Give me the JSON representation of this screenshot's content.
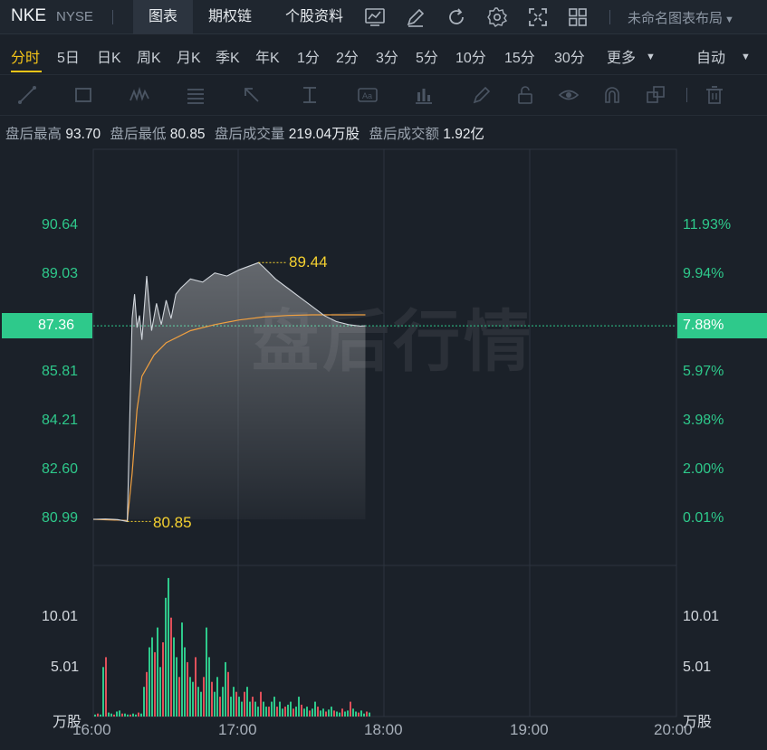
{
  "header": {
    "ticker": "NKE",
    "exchange": "NYSE",
    "tabs": [
      "图表",
      "期权链",
      "个股资料"
    ],
    "layout_name": "未命名图表布局"
  },
  "periods": {
    "items": [
      "分时",
      "5日",
      "日K",
      "周K",
      "月K",
      "季K",
      "年K",
      "1分",
      "2分",
      "3分",
      "5分",
      "10分",
      "15分",
      "30分",
      "更多"
    ],
    "active": "分时",
    "auto": "自动"
  },
  "toolbar_icons": [
    "trendline-icon",
    "rectangle-icon",
    "wave-icon",
    "fib-icon",
    "arrow-icon",
    "measure-icon",
    "text-icon",
    "indicator-icon",
    "pen-icon",
    "lock-icon",
    "eye-icon",
    "magnet-icon",
    "copy-icon",
    "trash-icon"
  ],
  "info": {
    "high_label": "盘后最高",
    "high_value": "93.70",
    "low_label": "盘后最低",
    "low_value": "80.85",
    "vol_label": "盘后成交量",
    "vol_value": "219.04万股",
    "amt_label": "盘后成交额",
    "amt_value": "1.92亿"
  },
  "axes": {
    "price_ticks": [
      "90.64",
      "89.03",
      "87.36",
      "85.81",
      "84.21",
      "82.60",
      "80.99"
    ],
    "pct_ticks": [
      "11.93%",
      "9.94%",
      "7.88%",
      "5.97%",
      "3.98%",
      "2.00%",
      "0.01%"
    ],
    "vol_ticks": [
      "10.01",
      "5.01"
    ],
    "vol_unit": "万股",
    "time_ticks": [
      "16:00",
      "17:00",
      "18:00",
      "19:00",
      "20:00"
    ]
  },
  "last_price": "87.36",
  "last_pct": "7.88%",
  "annotations": {
    "max_label": "89.44",
    "min_label": "80.85"
  },
  "watermark": "盘后行情",
  "chart_data": {
    "type": "line",
    "x_range": [
      "16:00",
      "20:00"
    ],
    "ylim": [
      80.99,
      90.64
    ],
    "series": [
      {
        "name": "price",
        "color": "#d0d5db",
        "x": [
          "16:00",
          "16:05",
          "16:10",
          "16:14",
          "16:15",
          "16:16",
          "16:17",
          "16:18",
          "16:19",
          "16:20",
          "16:22",
          "16:24",
          "16:26",
          "16:28",
          "16:30",
          "16:32",
          "16:34",
          "16:36",
          "16:40",
          "16:45",
          "16:50",
          "16:55",
          "17:00",
          "17:05",
          "17:08",
          "17:10",
          "17:15",
          "17:20",
          "17:25",
          "17:30",
          "17:35",
          "17:40",
          "17:45",
          "17:50",
          "17:52"
        ],
        "y": [
          80.99,
          81.0,
          80.98,
          80.92,
          84.3,
          87.6,
          88.4,
          87.3,
          87.7,
          86.9,
          89.0,
          87.2,
          88.1,
          87.4,
          88.2,
          87.6,
          88.4,
          88.6,
          88.9,
          88.8,
          89.1,
          89.0,
          89.2,
          89.35,
          89.44,
          89.3,
          88.9,
          88.6,
          88.3,
          88.0,
          87.7,
          87.5,
          87.4,
          87.35,
          87.36
        ]
      },
      {
        "name": "avg",
        "color": "#f0a040",
        "x": [
          "16:00",
          "16:14",
          "16:16",
          "16:18",
          "16:20",
          "16:25",
          "16:30",
          "16:40",
          "16:50",
          "17:00",
          "17:10",
          "17:20",
          "17:30",
          "17:40",
          "17:52"
        ],
        "y": [
          80.99,
          80.95,
          82.5,
          84.6,
          85.7,
          86.4,
          86.8,
          87.2,
          87.4,
          87.55,
          87.65,
          87.7,
          87.72,
          87.72,
          87.72
        ]
      }
    ],
    "volume": [
      0.2,
      0.3,
      0.2,
      5.0,
      6.0,
      0.4,
      0.3,
      0.2,
      0.5,
      0.6,
      0.3,
      0.3,
      0.2,
      0.2,
      0.3,
      0.2,
      0.4,
      0.3,
      3.0,
      4.5,
      7.0,
      8.0,
      6.5,
      9.0,
      5.0,
      7.5,
      12.0,
      14.0,
      10.0,
      8.0,
      6.0,
      4.0,
      9.5,
      7.0,
      5.5,
      4.0,
      3.5,
      6.0,
      3.0,
      2.5,
      4.0,
      9.0,
      6.0,
      3.5,
      2.5,
      4.0,
      2.0,
      3.0,
      5.5,
      4.5,
      2.0,
      3.0,
      2.5,
      2.0,
      1.5,
      2.5,
      3.0,
      1.5,
      2.0,
      1.5,
      1.0,
      2.5,
      1.5,
      1.0,
      1.0,
      1.5,
      2.0,
      1.0,
      1.5,
      0.8,
      1.0,
      1.2,
      1.5,
      0.8,
      1.0,
      2.0,
      1.2,
      0.8,
      1.0,
      0.6,
      0.8,
      1.5,
      1.0,
      0.6,
      0.8,
      0.5,
      0.7,
      1.0,
      0.6,
      0.5,
      0.4,
      0.8,
      0.5,
      0.6,
      1.5,
      0.8,
      0.5,
      0.4,
      0.6,
      0.3,
      0.5,
      0.4
    ],
    "volume_ylim": [
      0,
      15.0
    ],
    "grid": true
  }
}
